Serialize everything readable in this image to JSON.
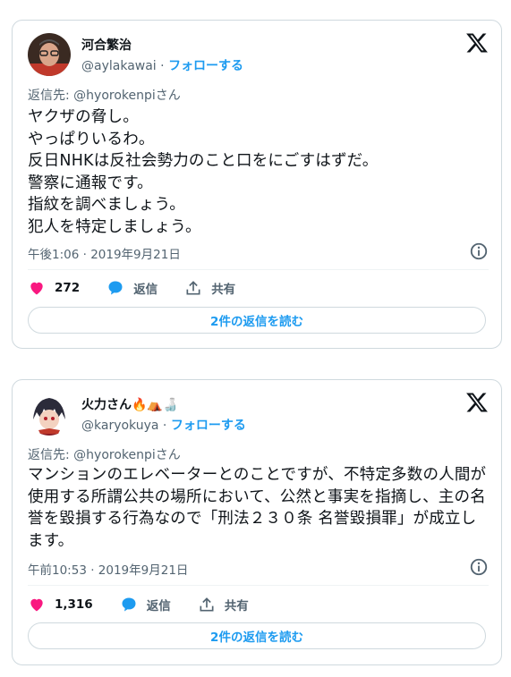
{
  "tweets": [
    {
      "author_name": "河合繁治",
      "handle": "@aylakawai",
      "separator": " · ",
      "follow_label": "フォローする",
      "reply_to": "返信先: @hyorokenpiさん",
      "body": "ヤクザの脅し。\nやっぱりいるわ。\n反日NHKは反社会勢力のこと口をにごすはずだ。\n警察に通報です。\n指紋を調べましょう。\n犯人を特定しましょう。",
      "timestamp": "午後1:06 · 2019年9月21日",
      "likes": "272",
      "reply_label": "返信",
      "share_label": "共有",
      "read_replies": "2件の返信を読む"
    },
    {
      "author_name": "火力さん",
      "name_emoji": "🔥⛺🍶",
      "handle": "@karyokuya",
      "separator": " · ",
      "follow_label": "フォローする",
      "reply_to": "返信先: @hyorokenpiさん",
      "body": "マンションのエレベーターとのことですが、不特定多数の人間が使用する所謂公共の場所において、公然と事実を指摘し、主の名誉を毀損する行為なので「刑法２３０条 名誉毀損罪」が成立します。",
      "timestamp": "午前10:53 · 2019年9月21日",
      "likes": "1,316",
      "reply_label": "返信",
      "share_label": "共有",
      "read_replies": "2件の返信を読む"
    }
  ],
  "colors": {
    "like": "#f91880",
    "reply": "#1d9bf0",
    "link": "#1d9bf0",
    "muted": "#536471"
  },
  "icons": [
    "x-logo-icon",
    "info-icon",
    "heart-icon",
    "reply-bubble-icon",
    "share-icon"
  ]
}
